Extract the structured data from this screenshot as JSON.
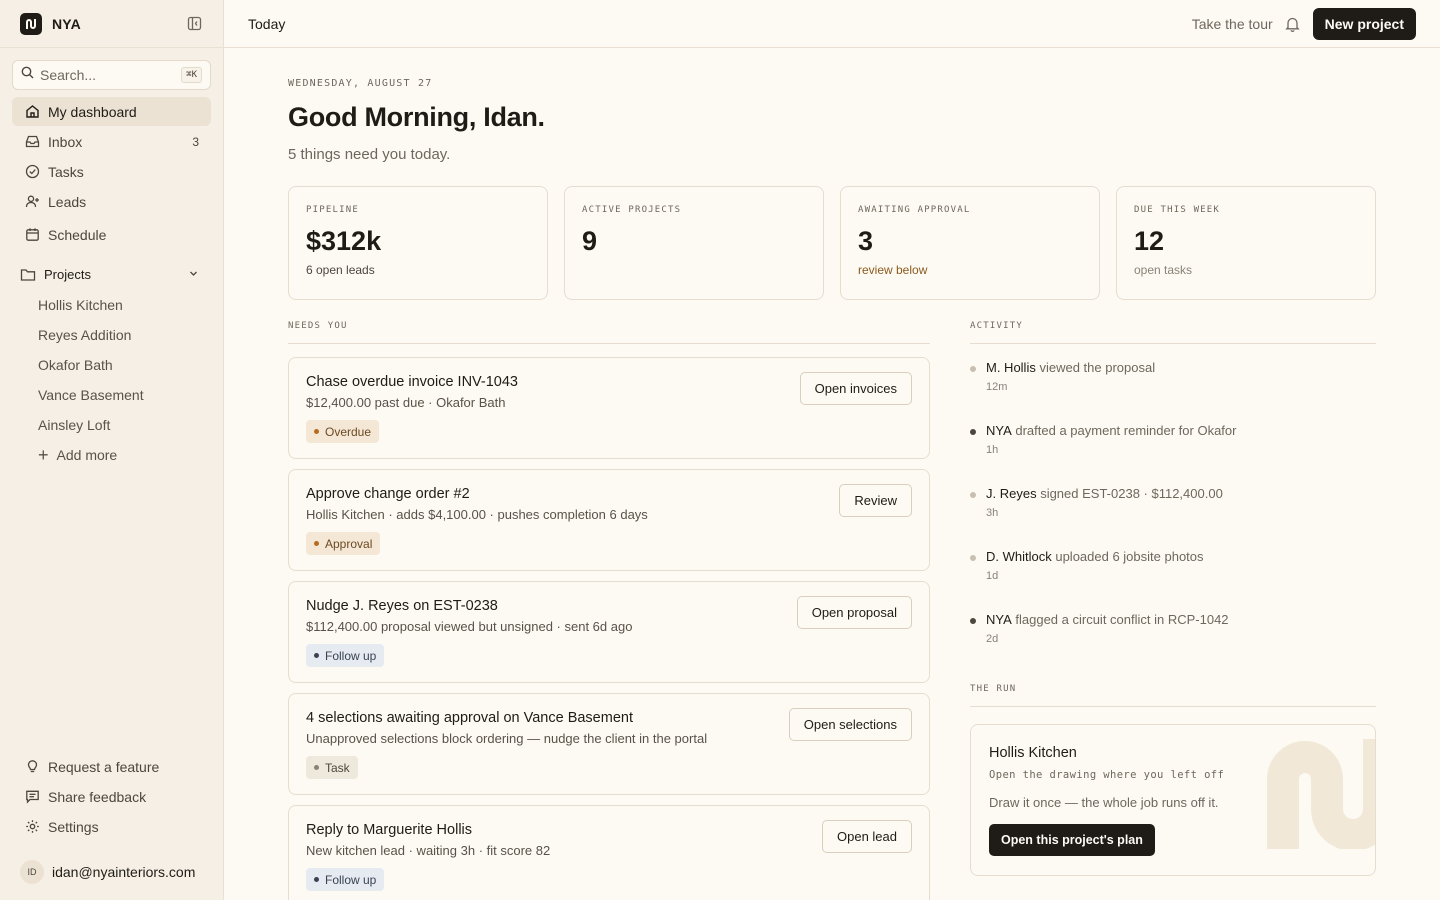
{
  "app": {
    "name": "NYA"
  },
  "sidebar": {
    "search_placeholder": "Search...",
    "search_shortcut": "⌘K",
    "nav": [
      {
        "label": "My dashboard",
        "icon": "home-icon",
        "active": true
      },
      {
        "label": "Inbox",
        "icon": "inbox-icon",
        "count": "3"
      },
      {
        "label": "Tasks",
        "icon": "check-circle-icon"
      },
      {
        "label": "Leads",
        "icon": "user-plus-icon"
      },
      {
        "label": "Schedule",
        "icon": "calendar-icon"
      }
    ],
    "projects_label": "Projects",
    "projects": [
      "Hollis Kitchen",
      "Reyes Addition",
      "Okafor Bath",
      "Vance Basement",
      "Ainsley Loft"
    ],
    "add_more": "Add more",
    "bottom": [
      {
        "label": "Request a feature",
        "icon": "lightbulb-icon"
      },
      {
        "label": "Share feedback",
        "icon": "message-icon"
      },
      {
        "label": "Settings",
        "icon": "gear-icon"
      }
    ],
    "user": {
      "initials": "ID",
      "email": "idan@nyainteriors.com"
    }
  },
  "topbar": {
    "title": "Today",
    "tour": "Take the tour",
    "new_project": "New project"
  },
  "main": {
    "date": "WEDNESDAY, AUGUST 27",
    "greeting": "Good Morning, Idan.",
    "subtitle": "5 things need you today.",
    "stats": [
      {
        "label": "PIPELINE",
        "value": "$312k",
        "sub": "6 open leads"
      },
      {
        "label": "ACTIVE PROJECTS",
        "value": "9",
        "sub": ""
      },
      {
        "label": "AWAITING APPROVAL",
        "value": "3",
        "sub": "review below"
      },
      {
        "label": "DUE THIS WEEK",
        "value": "12",
        "sub": "open tasks"
      }
    ],
    "needs_label": "NEEDS YOU",
    "tasks": [
      {
        "title": "Chase overdue invoice INV-1043",
        "desc": "$12,400.00 past due · Okafor Bath",
        "tag": "Overdue",
        "button": "Open invoices"
      },
      {
        "title": "Approve change order #2",
        "desc": "Hollis Kitchen · adds $4,100.00 · pushes completion 6 days",
        "tag": "Approval",
        "button": "Review"
      },
      {
        "title": "Nudge J. Reyes on EST-0238",
        "desc": "$112,400.00 proposal viewed but unsigned · sent 6d ago",
        "tag": "Follow up",
        "button": "Open proposal"
      },
      {
        "title": "4 selections awaiting approval on Vance Basement",
        "desc": "Unapproved selections block ordering — nudge the client in the portal",
        "tag": "Task",
        "button": "Open selections"
      },
      {
        "title": "Reply to Marguerite Hollis",
        "desc": "New kitchen lead · waiting 3h · fit score 82",
        "tag": "Follow up",
        "button": "Open lead"
      }
    ],
    "activity_label": "ACTIVITY",
    "activity": [
      {
        "who": "M. Hollis",
        "what": " viewed the proposal",
        "time": "12m"
      },
      {
        "who": "NYA",
        "what": " drafted a payment reminder for Okafor",
        "time": "1h"
      },
      {
        "who": "J. Reyes",
        "what": " signed EST-0238 · $112,400.00",
        "time": "3h"
      },
      {
        "who": "D. Whitlock",
        "what": " uploaded 6 jobsite photos",
        "time": "1d"
      },
      {
        "who": "NYA",
        "what": " flagged a circuit conflict in RCP-1042",
        "time": "2d"
      }
    ],
    "run_label": "THE RUN",
    "run": {
      "title": "Hollis Kitchen",
      "subtitle": "Open the drawing where you left off",
      "desc": "Draw it once — the whole job runs off it.",
      "button": "Open this project's plan"
    }
  }
}
